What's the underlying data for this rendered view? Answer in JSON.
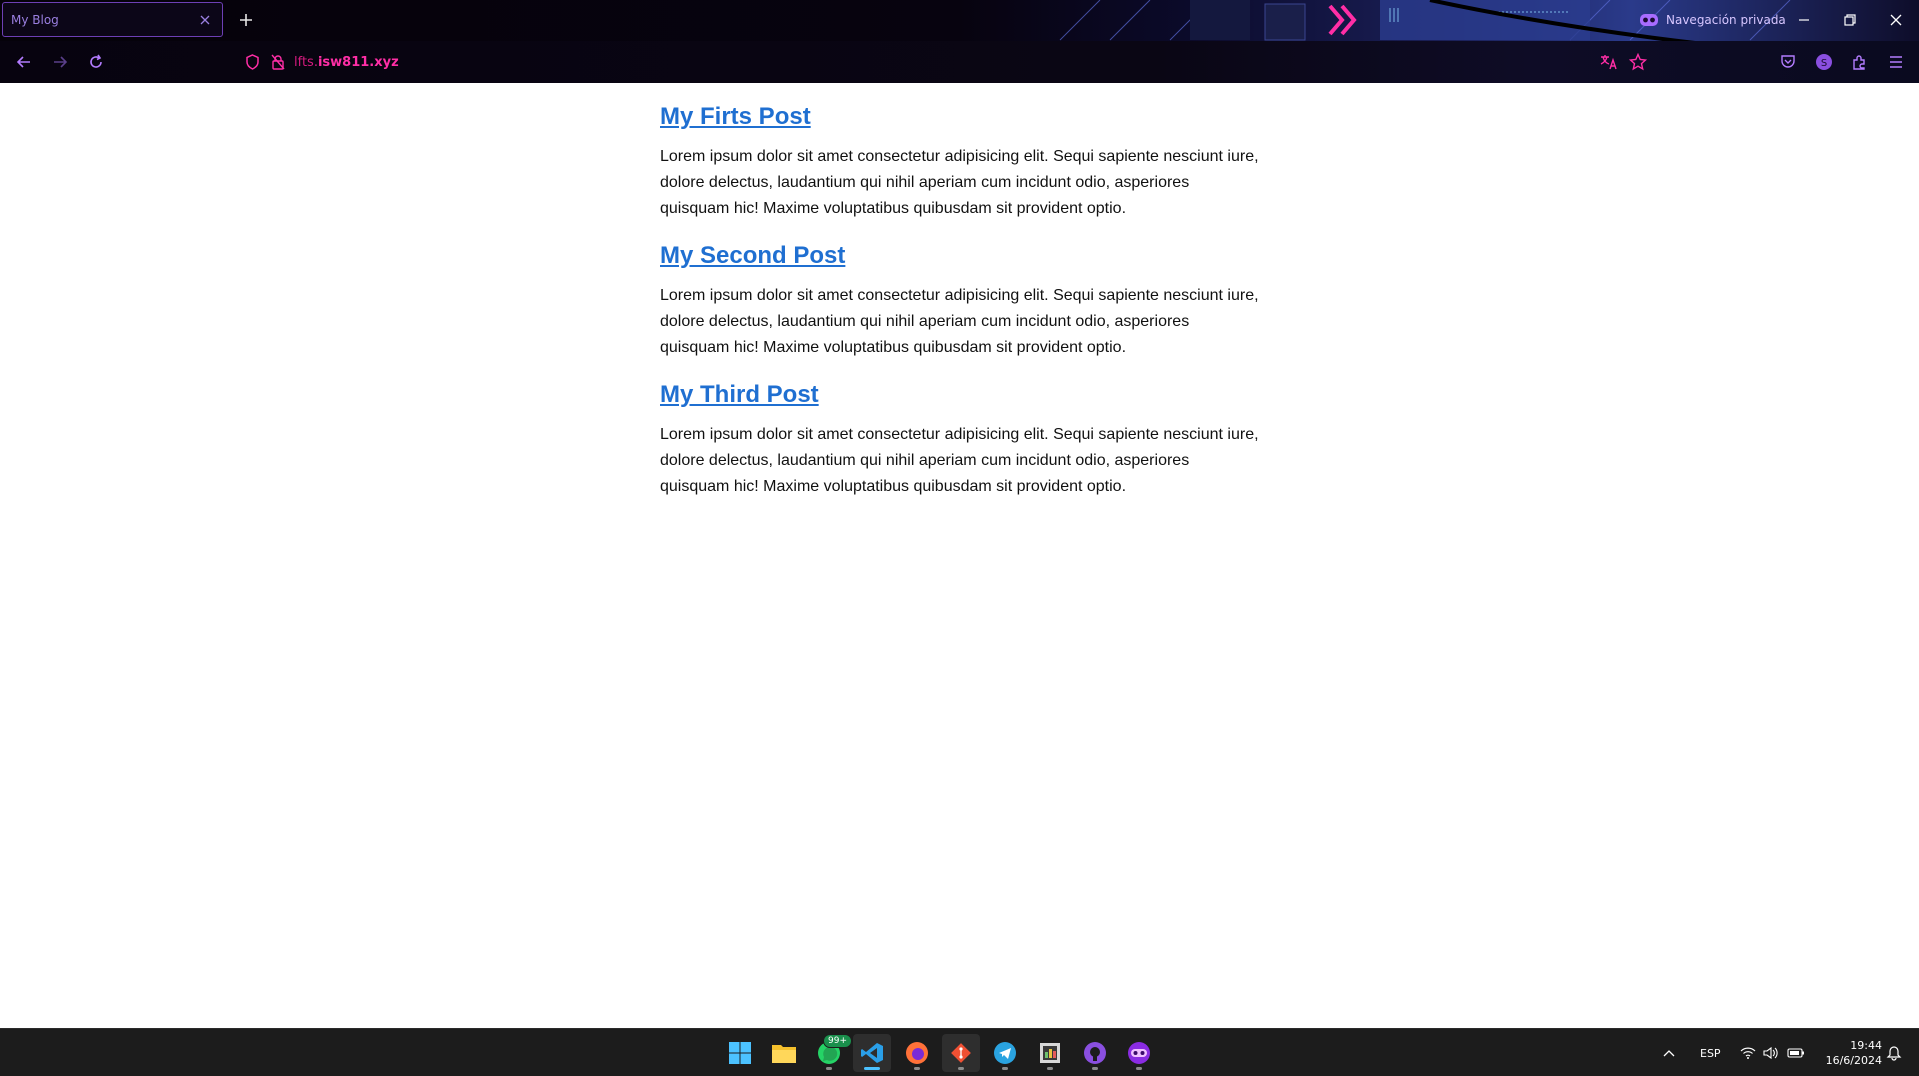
{
  "browser": {
    "tab_title": "My Blog",
    "private_label": "Navegación privada",
    "url": {
      "subdomain": "lfts.",
      "domain": "isw811.xyz"
    }
  },
  "page": {
    "posts": [
      {
        "title": "My Firts Post",
        "body": "Lorem ipsum dolor sit amet consectetur adipisicing elit. Sequi sapiente nesciunt iure, dolore delectus, laudantium qui nihil aperiam cum incidunt odio, asperiores quisquam hic! Maxime voluptatibus quibusdam sit provident optio."
      },
      {
        "title": "My Second Post",
        "body": "Lorem ipsum dolor sit amet consectetur adipisicing elit. Sequi sapiente nesciunt iure, dolore delectus, laudantium qui nihil aperiam cum incidunt odio, asperiores quisquam hic! Maxime voluptatibus quibusdam sit provident optio."
      },
      {
        "title": "My Third Post",
        "body": "Lorem ipsum dolor sit amet consectetur adipisicing elit. Sequi sapiente nesciunt iure, dolore delectus, laudantium qui nihil aperiam cum incidunt odio, asperiores quisquam hic! Maxime voluptatibus quibusdam sit provident optio."
      }
    ]
  },
  "taskbar": {
    "apps": [
      {
        "name": "windows-start-icon"
      },
      {
        "name": "file-explorer-icon"
      },
      {
        "name": "whatsapp-icon",
        "badge": "99+"
      },
      {
        "name": "vscode-icon"
      },
      {
        "name": "firefox-icon"
      },
      {
        "name": "git-icon"
      },
      {
        "name": "telegram-icon"
      },
      {
        "name": "image-viewer-icon"
      },
      {
        "name": "github-desktop-icon"
      },
      {
        "name": "firefox-private-icon"
      }
    ],
    "language": "ESP",
    "time": "19:44",
    "date": "16/6/2024"
  },
  "colors": {
    "link": "#1f6fd1",
    "accent": "#ff2ea6",
    "chrome_bg": "#07030f",
    "taskbar_bg": "#1c1c1c"
  }
}
